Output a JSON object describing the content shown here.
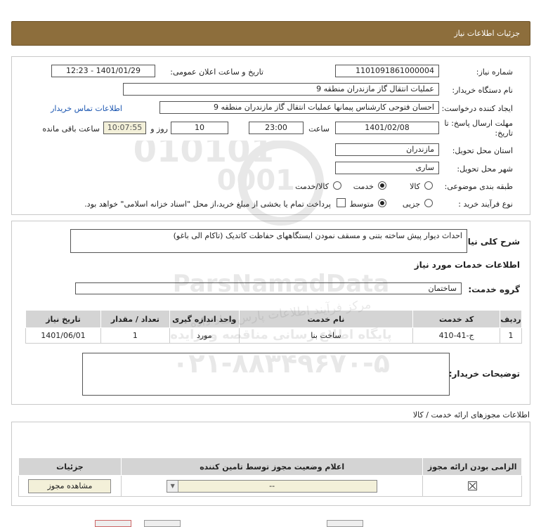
{
  "page_title": "جزئیات اطلاعات نیاز",
  "labels": {
    "need_number": "شماره نیاز:",
    "announce_datetime": "تاریخ و ساعت اعلان عمومی:",
    "buyer_org": "نام دستگاه خریدار:",
    "requester": "ایجاد کننده درخواست:",
    "deadline": "مهلت ارسال پاسخ: تا",
    "deadline_2": "تاریخ:",
    "time_word": "ساعت",
    "day_word": "روز و",
    "remaining": "ساعت باقی مانده",
    "province": "استان محل تحویل:",
    "city": "شهر محل تحویل:",
    "category": "طبقه بندی موضوعی:",
    "process_type": "نوع فرآیند خرید :",
    "general_desc": "شرح کلی نیاز:",
    "services_info": "اطلاعات خدمات مورد نیاز",
    "service_group": "گروه خدمت:",
    "buyer_notes": "توضیحات خریدار:",
    "permits_info": "اطلاعات مجوزهای ارائه خدمت / کالا"
  },
  "values": {
    "need_number": "1101091861000004",
    "announce_datetime": "1401/01/29 - 12:23",
    "buyer_org": "عملیات انتقال گاز مازندران منطقه 9",
    "requester": "احسان فتوحی کارشناس پیمانها عملیات انتقال گاز مازندران منطقه 9",
    "contact_link": "اطلاعات تماس خریدار",
    "deadline_date": "1401/02/08",
    "deadline_time": "23:00",
    "deadline_days": "10",
    "remaining_time": "10:07:55",
    "province": "مازندران",
    "city": "ساری",
    "general_desc": "احداث دیوار پیش ساخته بتنی و مسقف نمودن ایستگاههای حفاظت کاتدیک (تاکام الی باغو)",
    "service_group": "ساختمان"
  },
  "category_options": [
    {
      "label": "کالا",
      "selected": false
    },
    {
      "label": "خدمت",
      "selected": true
    },
    {
      "label": "کالا/خدمت",
      "selected": false
    }
  ],
  "process_options": [
    {
      "label": "جزیی",
      "selected": false
    },
    {
      "label": "متوسط",
      "selected": true
    }
  ],
  "process_note": "پرداخت تمام یا بخشی از مبلغ خرید،از محل \"اسناد خزانه اسلامی\" خواهد بود.",
  "services_table": {
    "headers": [
      "ردیف",
      "کد خدمت",
      "نام خدمت",
      "واحد اندازه گیری",
      "تعداد / مقدار",
      "تاریخ نیاز"
    ],
    "rows": [
      [
        "1",
        "ج-41-410",
        "ساخت بنا",
        "مورد",
        "1",
        "1401/06/01"
      ]
    ]
  },
  "permits_table": {
    "headers": [
      "الزامی بودن ارائه مجوز",
      "اعلام وضعیت مجوز توسط تامین کننده",
      "جزئیات"
    ],
    "status_value": "--",
    "view_button": "مشاهده مجوز"
  },
  "watermark": {
    "brand": "ParsNamadData",
    "line1": "مرکز فرآیند اطلاعات پارس نماد داده",
    "line2": "پایگاه اطلاع رسانی مناقصه ومزایده",
    "phone": "۰۲۱-۸۸۳۴۹۶۷۰-۵"
  },
  "colors": {
    "title_bar": "#8d6e3c",
    "table_header": "#d4d4d4",
    "link": "#1a55b0",
    "remaining_bg": "#f3f0d9"
  }
}
